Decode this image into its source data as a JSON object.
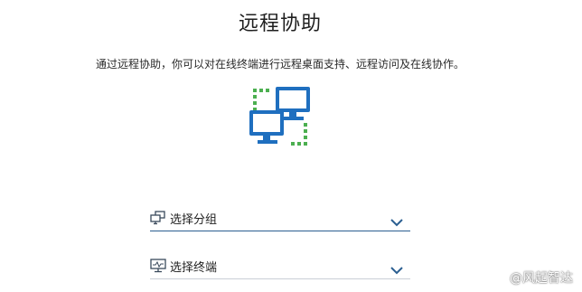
{
  "page": {
    "title": "远程协助",
    "description": "通过远程协助，你可以对在线终端进行远程桌面支持、远程访问及在线协作。"
  },
  "hero": {
    "icon": "remote-computers-icon",
    "colors": {
      "monitor": "#1f6fbf",
      "dots": "#4caf50"
    }
  },
  "selects": {
    "group": {
      "label": "选择分组",
      "icon": "group-computers-icon"
    },
    "terminal": {
      "label": "选择终端",
      "icon": "terminal-monitor-icon"
    }
  },
  "watermark": {
    "text": "@风起智达"
  },
  "colors": {
    "accent": "#2b5f91",
    "chevron": "#2b5f91"
  }
}
